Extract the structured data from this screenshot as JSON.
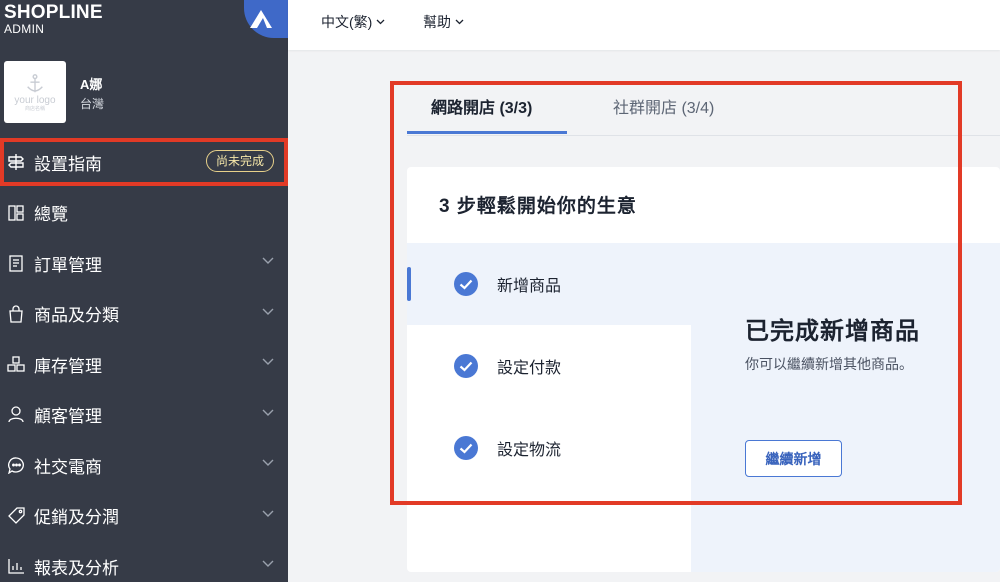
{
  "brand": {
    "name": "SHOPLINE",
    "sub": "ADMIN"
  },
  "store": {
    "name": "A娜",
    "region": "台灣",
    "logo_text": "your logo",
    "logo_sub": "商店名稱"
  },
  "sidebar": {
    "items": [
      {
        "label": "設置指南",
        "icon": "signpost-icon",
        "badge": "尚未完成"
      },
      {
        "label": "總覽",
        "icon": "dashboard-icon"
      },
      {
        "label": "訂單管理",
        "icon": "order-icon"
      },
      {
        "label": "商品及分類",
        "icon": "shopping-bag-icon"
      },
      {
        "label": "庫存管理",
        "icon": "inventory-icon"
      },
      {
        "label": "顧客管理",
        "icon": "user-icon"
      },
      {
        "label": "社交電商",
        "icon": "chat-icon"
      },
      {
        "label": "促銷及分潤",
        "icon": "tag-icon"
      },
      {
        "label": "報表及分析",
        "icon": "chart-icon"
      }
    ]
  },
  "topbar": {
    "language": "中文(繁)",
    "help": "幫助"
  },
  "tabs": [
    {
      "label": "網路開店 (3/3)",
      "active": true
    },
    {
      "label": "社群開店 (3/4)",
      "active": false
    }
  ],
  "card": {
    "title": "3 步輕鬆開始你的生意",
    "steps": [
      {
        "label": "新增商品",
        "done": true
      },
      {
        "label": "設定付款",
        "done": true
      },
      {
        "label": "設定物流",
        "done": true
      }
    ],
    "detail": {
      "title": "已完成新增商品",
      "description": "你可以繼續新增其他商品。",
      "button": "繼續新增"
    }
  },
  "colors": {
    "sidebar_bg": "#363b47",
    "accent": "#4a78d4",
    "highlight": "#e23a26",
    "badge": "#e7d08a"
  }
}
